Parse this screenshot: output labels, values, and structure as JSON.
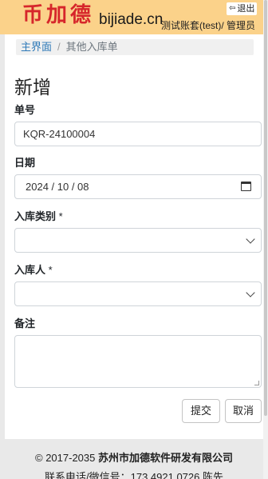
{
  "header": {
    "logo_text": "币加德",
    "domain": "bijiade.cn",
    "logout_label": "退出",
    "user_line": "测试账套(test)/ 管理员",
    "bg_color": "#fbd28a",
    "logo_color": "#d6262b"
  },
  "breadcrumb": {
    "home": "主界面",
    "current": "其他入库单"
  },
  "form": {
    "title": "新增",
    "number_label": "单号",
    "number_value": "KQR-24100004",
    "date_label": "日期",
    "date_value": "2024 / 10 / 08",
    "category_label": "入库类别",
    "category_required": "*",
    "category_value": "",
    "person_label": "入库人",
    "person_required": "*",
    "person_value": "",
    "remark_label": "备注",
    "remark_value": ""
  },
  "buttons": {
    "submit": "提交",
    "cancel": "取消"
  },
  "footer": {
    "copyright": "© 2017-2035",
    "company": "苏州市加德软件研发有限公司",
    "contact_partial": "联系电话/微信号：173 4921 0726 陈先"
  }
}
